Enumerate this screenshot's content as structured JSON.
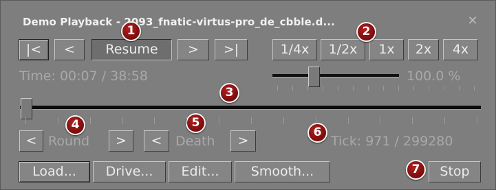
{
  "window": {
    "title": "Demo Playback - 2093_fnatic-virtus-pro_de_cbble.d...",
    "close_glyph": "✕"
  },
  "transport": {
    "first_label": "|<",
    "prev_label": "<",
    "resume_label": "Resume",
    "next_label": ">",
    "last_label": ">|"
  },
  "speed_buttons": [
    "1/4x",
    "1/2x",
    "1x",
    "2x",
    "4x"
  ],
  "time": {
    "text": "Time: 00:07 / 38:58"
  },
  "speed": {
    "percent_text": "100.0 %",
    "level": 0.33
  },
  "timeline": {
    "position": 0.0032
  },
  "round": {
    "prev": "<",
    "label": "Round",
    "next": ">"
  },
  "death": {
    "prev": "<",
    "label": "Death",
    "next": ">"
  },
  "tick": {
    "text": "Tick: 971 / 299280"
  },
  "bottom_buttons": {
    "load": "Load...",
    "drive": "Drive...",
    "edit": "Edit...",
    "smooth": "Smooth...",
    "stop": "Stop"
  },
  "callouts": [
    "1",
    "2",
    "3",
    "4",
    "5",
    "6",
    "7"
  ],
  "colors": {
    "callout_red": "#9c1414",
    "panel": "#7e7e7e",
    "text": "#ececec"
  }
}
